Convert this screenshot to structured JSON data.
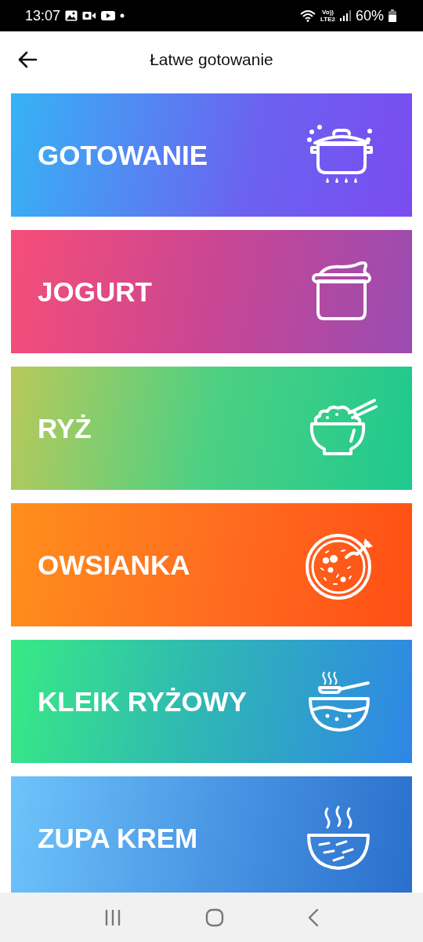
{
  "status_bar": {
    "time": "13:07",
    "volte": "Vo))",
    "network": "LTE2",
    "battery": "60%"
  },
  "app_bar": {
    "title": "Łatwe gotowanie"
  },
  "categories": [
    {
      "label": "GOTOWANIE",
      "kind": "pot"
    },
    {
      "label": "JOGURT",
      "kind": "yogurt"
    },
    {
      "label": "RYŻ",
      "kind": "rice"
    },
    {
      "label": "OWSIANKA",
      "kind": "porridge"
    },
    {
      "label": "KLEIK RYŻOWY",
      "kind": "gruel"
    },
    {
      "label": "ZUPA KREM",
      "kind": "soup"
    }
  ]
}
